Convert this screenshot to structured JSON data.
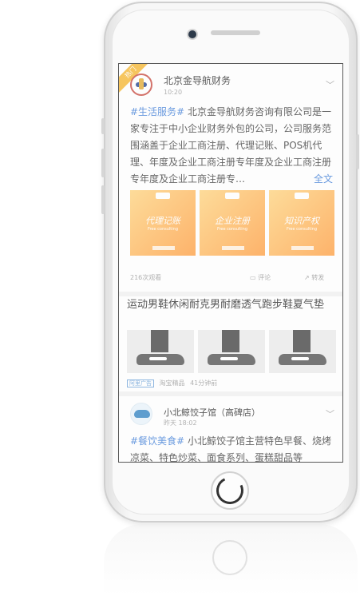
{
  "post1": {
    "corner_tag": "热门",
    "author": "北京金导航财务",
    "time": "10:20",
    "hashtag": "#生活服务#",
    "body": " 北京金导航财务咨询有限公司是一家专注于中小企业财务外包的公司，公司服务范围涵盖于企业工商注册、代理记账、POS机代理、年度及企业工商注册专年度及企业工商注册专年度及企业工商注册专…",
    "more_label": "全文",
    "thumbnails": [
      {
        "title": "代理记账",
        "sub": "Free consulting"
      },
      {
        "title": "企业注册",
        "sub": "Free consulting"
      },
      {
        "title": "知识产权",
        "sub": "Free consulting"
      }
    ],
    "views": "216次观看",
    "comment_label": "评论",
    "share_label": "转发"
  },
  "ad": {
    "title": "运动男鞋休闲耐克男耐磨透气跑步鞋夏气垫",
    "badge": "阿里广告",
    "source": "淘宝精品",
    "time": "41分钟前"
  },
  "post2": {
    "author": "小北鲸饺子馆（高碑店）",
    "time": "昨天 18:02",
    "hashtag": "#餐饮美食#",
    "body": " 小北鲸饺子馆主营特色早餐、烧烤凉菜、特色炒菜、面食系列、蛋糕甜品等"
  },
  "icons": [
    "chevron-down-icon",
    "comment-icon",
    "share-icon",
    "home-button-icon"
  ]
}
